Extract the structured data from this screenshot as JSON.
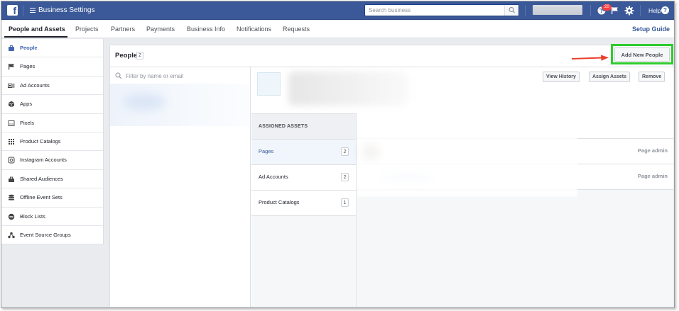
{
  "topbar": {
    "app_title": "Business Settings",
    "search_placeholder": "Search business",
    "notification_count": "20",
    "help_label": "Help",
    "help_icon_glyph": "?",
    "logo_glyph": "f",
    "icons": [
      "facebook-logo",
      "menu-icon",
      "search-icon",
      "globe-icon",
      "flag-icon",
      "gear-icon",
      "help-icon"
    ]
  },
  "tabs": [
    {
      "label": "People and Assets",
      "active": true
    },
    {
      "label": "Projects"
    },
    {
      "label": "Partners"
    },
    {
      "label": "Payments"
    },
    {
      "label": "Business Info"
    },
    {
      "label": "Notifications"
    },
    {
      "label": "Requests"
    }
  ],
  "setup_guide_label": "Setup Guide",
  "sidebar": {
    "items": [
      {
        "label": "People",
        "icon": "briefcase-icon",
        "active": true
      },
      {
        "label": "Pages",
        "icon": "flag-icon"
      },
      {
        "label": "Ad Accounts",
        "icon": "ad-accounts-icon"
      },
      {
        "label": "Apps",
        "icon": "cube-icon"
      },
      {
        "label": "Pixels",
        "icon": "pixel-icon"
      },
      {
        "label": "Product Catalogs",
        "icon": "grid-icon"
      },
      {
        "label": "Instagram Accounts",
        "icon": "instagram-icon"
      },
      {
        "label": "Shared Audiences",
        "icon": "audiences-icon"
      },
      {
        "label": "Offline Event Sets",
        "icon": "offline-events-icon"
      },
      {
        "label": "Block Lists",
        "icon": "block-icon"
      },
      {
        "label": "Event Source Groups",
        "icon": "event-source-icon"
      }
    ]
  },
  "people_panel": {
    "title": "People",
    "count": "2",
    "filter_placeholder": "Filter by name or email",
    "add_button": "Add New People"
  },
  "detail": {
    "actions": {
      "view_history": "View History",
      "assign_assets": "Assign Assets",
      "remove": "Remove"
    },
    "assigned_assets_header": "ASSIGNED ASSETS",
    "assets": [
      {
        "label": "Pages",
        "count": "2",
        "active": true
      },
      {
        "label": "Ad Accounts",
        "count": "2"
      },
      {
        "label": "Product Catalogs",
        "count": "1"
      }
    ],
    "rows": [
      {
        "role": "Page admin"
      },
      {
        "role": "Page admin"
      }
    ]
  },
  "colors": {
    "brand_blue": "#3b5998",
    "link_blue": "#365899",
    "highlight_green": "#2ecc2e",
    "arrow_red": "#e8412c"
  }
}
